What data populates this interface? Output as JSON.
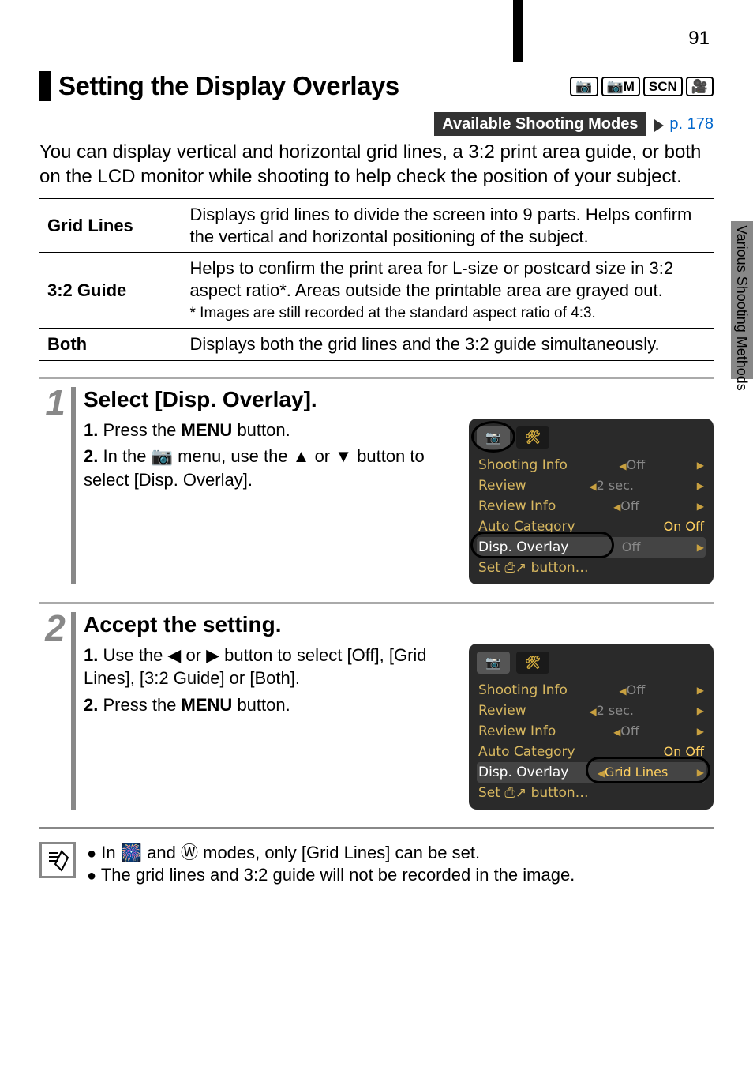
{
  "page_number": "91",
  "title": "Setting the Display Overlays",
  "mode_icons": [
    "📷",
    "📷M",
    "SCN",
    "🎥"
  ],
  "avail_label": "Available Shooting Modes",
  "avail_link": "p. 178",
  "intro": "You can display vertical and horizontal grid lines, a 3:2 print area guide, or both on the LCD monitor while shooting to help check the position of your subject.",
  "options": [
    {
      "name": "Grid Lines",
      "desc": "Displays grid lines to divide the screen into 9 parts. Helps confirm the vertical and horizontal positioning of the subject."
    },
    {
      "name": "3:2 Guide",
      "desc": "Helps to confirm the print area for L-size or postcard size in 3:2 aspect ratio*. Areas outside the printable area are grayed out.",
      "foot": "* Images are still recorded at the standard aspect ratio of 4:3."
    },
    {
      "name": "Both",
      "desc": "Displays both the grid lines and the 3:2 guide simultaneously."
    }
  ],
  "steps": [
    {
      "num": "1",
      "head": "Select [Disp. Overlay].",
      "lines": [
        {
          "n": "1.",
          "t": "Press the ",
          "bold": "MENU",
          "after": " button."
        },
        {
          "n": "2.",
          "t": "In the 📷 menu, use the ▲ or ▼ button to select [Disp. Overlay]."
        }
      ],
      "shot": {
        "tab_active": 0,
        "rows": [
          {
            "lab": "Shooting Info",
            "val": "Off"
          },
          {
            "lab": "Review",
            "val": "2 sec."
          },
          {
            "lab": "Review Info",
            "val": "Off"
          },
          {
            "lab": "Auto Category",
            "val": "On Off",
            "on": true
          },
          {
            "lab": "Disp. Overlay",
            "val": "Off",
            "hl": true
          },
          {
            "lab": "Set ⎙↗ button…",
            "val": ""
          }
        ],
        "ann": {
          "tabcircle": true,
          "rowoval": 4
        }
      }
    },
    {
      "num": "2",
      "head": "Accept the setting.",
      "lines": [
        {
          "n": "1.",
          "t": "Use the ◀ or ▶ button to select [Off], [Grid Lines], [3:2 Guide] or [Both]."
        },
        {
          "n": "2.",
          "t": "Press the ",
          "bold": "MENU",
          "after": " button."
        }
      ],
      "shot": {
        "tab_active": 0,
        "rows": [
          {
            "lab": "Shooting Info",
            "val": "Off"
          },
          {
            "lab": "Review",
            "val": "2 sec."
          },
          {
            "lab": "Review Info",
            "val": "Off"
          },
          {
            "lab": "Auto Category",
            "val": "On Off",
            "on": true
          },
          {
            "lab": "Disp. Overlay",
            "val": "Grid Lines",
            "hl": true,
            "wide": true
          },
          {
            "lab": "Set ⎙↗ button…",
            "val": ""
          }
        ],
        "ann": {
          "valcircle": 4
        }
      }
    }
  ],
  "notes": [
    "In 🎆 and Ⓦ modes, only [Grid Lines] can be set.",
    "The grid lines and 3:2 guide will not be recorded in the image."
  ],
  "side_label": "Various Shooting Methods"
}
